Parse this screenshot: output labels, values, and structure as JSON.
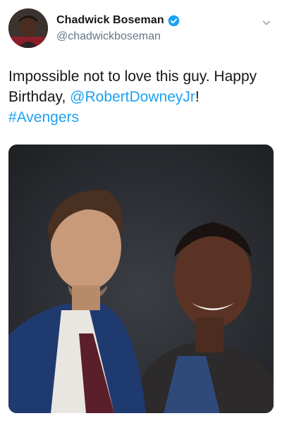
{
  "author": {
    "display_name": "Chadwick Boseman",
    "handle": "@chadwickboseman",
    "verified": true
  },
  "tweet": {
    "text_part1": "Impossible not to love this guy. Happy Birthday, ",
    "mention": "@RobertDowneyJr",
    "text_part2": "!",
    "hashtag": "#Avengers"
  },
  "colors": {
    "link": "#1da1f2",
    "text": "#14171a",
    "secondary": "#657786"
  },
  "icons": {
    "verified": "verified-badge-icon",
    "caret": "chevron-down-icon"
  }
}
